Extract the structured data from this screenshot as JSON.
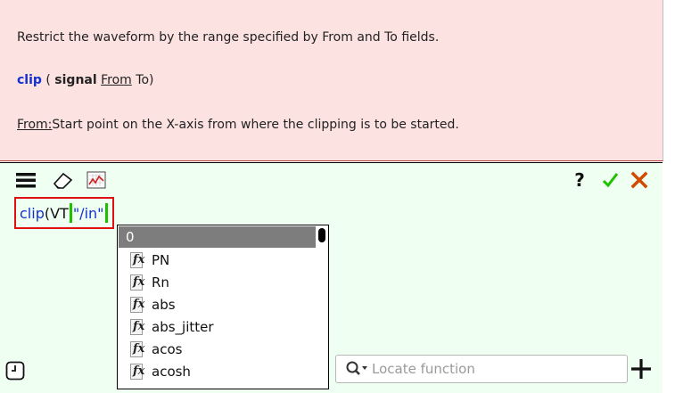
{
  "help": {
    "description": "Restrict the waveform by the range specified by From and To fields.",
    "syntax": {
      "fn": "clip",
      "open": " ( ",
      "signal": "signal",
      "from": "From",
      "to": "To)"
    },
    "param": {
      "name": "From:",
      "text": "Start point on the X-axis from where the clipping is to be started."
    }
  },
  "toolbar": {
    "help_label": "?",
    "icons": [
      "menu-icon",
      "eraser-icon",
      "chart-icon",
      "checkmark-icon",
      "close-icon"
    ],
    "colors": {
      "accept": "#1ec000",
      "cancel": "#d04a00"
    }
  },
  "expression": {
    "fn": "clip",
    "open": "(",
    "signal": "VT",
    "arg": "\"/in\""
  },
  "dropdown": {
    "selected": "0",
    "items": [
      "PN",
      "Rn",
      "abs",
      "abs_jitter",
      "acos",
      "acosh"
    ]
  },
  "search": {
    "placeholder": "Locate function"
  },
  "colors": {
    "help_bg": "#fde2e2",
    "calc_bg": "#effff2",
    "highlight_border": "#e01010",
    "function_blue": "#1530d0"
  }
}
